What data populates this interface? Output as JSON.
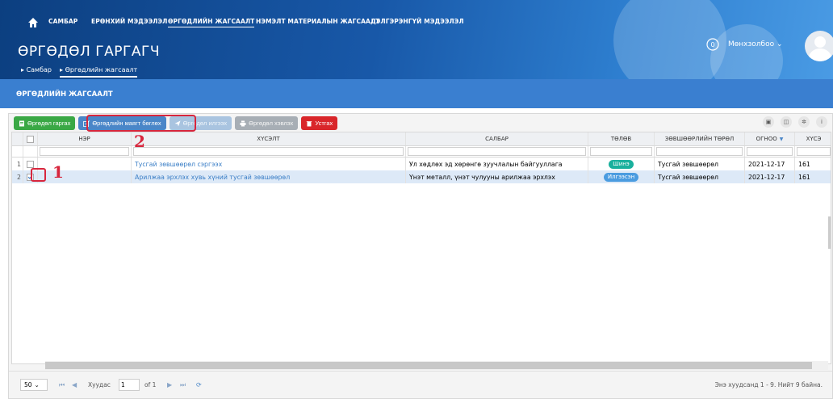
{
  "header": {
    "nav": [
      "САМБАР",
      "ЕРӨНХИЙ МЭДЭЭЛЭЛ",
      "ӨРГӨДЛИЙН ЖАГСААЛТ",
      "НЭМЭЛТ МАТЕРИАЛЫН ЖАГСААЛТ",
      "ДЭЛГЭРЭНГҮЙ МЭДЭЭЛЭЛ"
    ],
    "title": "ӨРГӨДӨЛ ГАРГАГЧ",
    "breadcrumb": [
      "Самбар",
      "Өргөдлийн жагсаалт"
    ],
    "user_name": "Мөнхзолбоо"
  },
  "section_title": "ӨРГӨДЛИЙН ЖАГСААЛТ",
  "toolbar": {
    "submit": "Өргөдөл гаргах",
    "fill_form": "Өргөдлийн маягт бөглөх",
    "send": "Өргөдөл илгээх",
    "print": "Өргөдөл хэвлэх",
    "delete": "Устгах"
  },
  "grid": {
    "columns": [
      "НЭР",
      "ХҮСЭЛТ",
      "САЛБАР",
      "ТӨЛӨВ",
      "ЗӨВШӨӨРЛИЙН ТӨРӨЛ",
      "ОГНОО",
      "ХҮСЭ"
    ],
    "rows": [
      {
        "num": "1",
        "request": "Тусгай зөвшөөрөл сэргээх",
        "category": "Ул хөдлөх эд хөрөнгө зуучлалын байгууллага",
        "status": "Шинэ",
        "type": "Тусгай зөвшөөрөл",
        "date": "2021-12-17",
        "reqnum": "161"
      },
      {
        "num": "2",
        "request": "Арилжаа эрхлэх хувь хүний тусгай зөвшөөрөл",
        "category": "Үнэт металл, үнэт чулууны арилжаа эрхлэх",
        "status": "Илгээсэн",
        "type": "Тусгай зөвшөөрөл",
        "date": "2021-12-17",
        "reqnum": "161"
      }
    ]
  },
  "pager": {
    "page_size": "50",
    "page_label": "Хуудас",
    "page_value": "1",
    "of_label": "of 1",
    "info": "Энэ хуудсанд 1 - 9. Нийт 9 байна."
  },
  "callouts": [
    "1",
    "2"
  ],
  "colors": {
    "accent": "#1858a8",
    "highlight": "#d7263d",
    "green": "#3aa845",
    "red": "#d9262a"
  }
}
